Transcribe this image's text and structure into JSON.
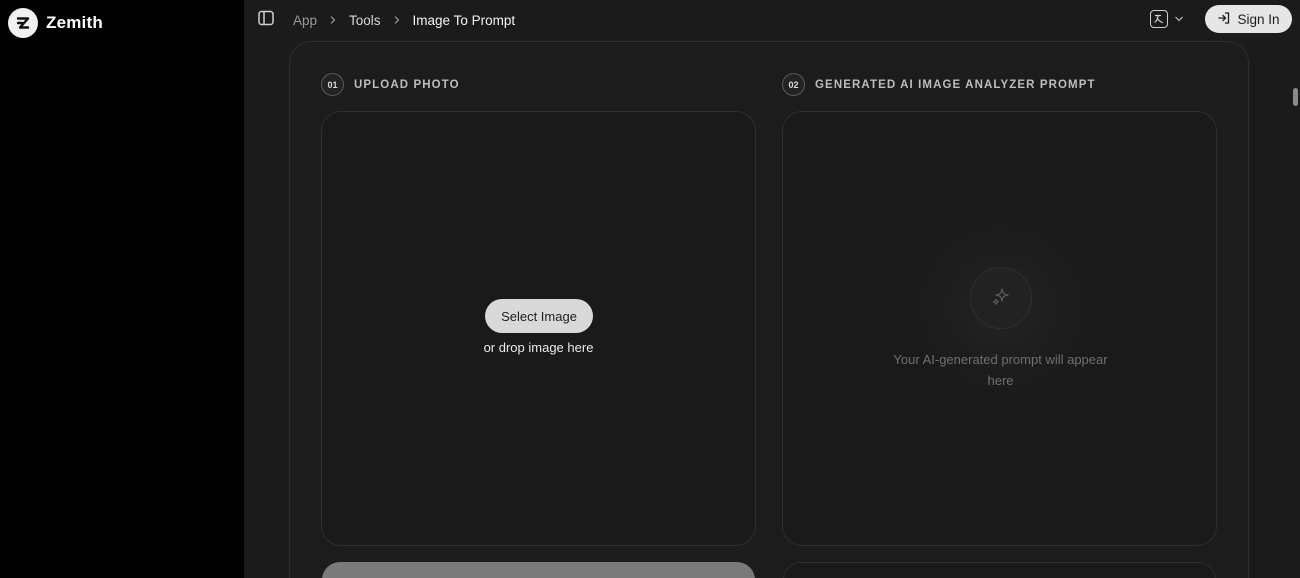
{
  "brand": {
    "name": "Zemith"
  },
  "breadcrumb": [
    {
      "label": "App"
    },
    {
      "label": "Tools"
    },
    {
      "label": "Image To Prompt"
    }
  ],
  "header": {
    "signin_label": "Sign In",
    "language_icon": "translate-icon"
  },
  "steps": {
    "upload": {
      "number": "01",
      "label": "UPLOAD PHOTO"
    },
    "output": {
      "number": "02",
      "label": "GENERATED AI IMAGE ANALYZER PROMPT"
    }
  },
  "upload": {
    "select_label": "Select Image",
    "drop_text": "or drop image here"
  },
  "output": {
    "placeholder": "Your AI-generated prompt will appear here"
  },
  "colors": {
    "sidebar_bg": "#000000",
    "page_bg": "#1b1b1b",
    "button_light": "#d9d9d9"
  }
}
